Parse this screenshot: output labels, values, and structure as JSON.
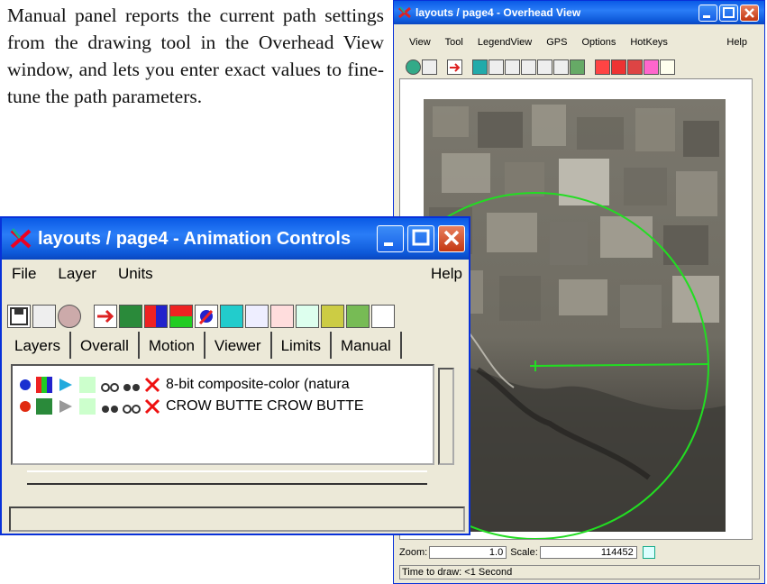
{
  "doc": {
    "paragraph": "Manual panel reports the current path settings from the drawing tool in the Overhead View window, and lets you enter exact values to fine-tune the path parameters."
  },
  "overhead_view": {
    "title": "layouts / page4 - Overhead View",
    "menu": [
      "View",
      "Tool",
      "LegendView",
      "GPS",
      "Options",
      "HotKeys"
    ],
    "menu_help": "Help",
    "zoom_label": "Zoom:",
    "zoom_value": "1.0",
    "scale_label": "Scale:",
    "scale_value": "114452",
    "time_to_draw": "Time to draw: <1 Second"
  },
  "animation_controls": {
    "title": "layouts / page4 - Animation Controls",
    "menu": [
      "File",
      "Layer",
      "Units"
    ],
    "menu_help": "Help",
    "tabs": [
      "Layers",
      "Overall",
      "Motion",
      "Viewer",
      "Limits",
      "Manual"
    ],
    "layers": [
      {
        "name": "8-bit composite-color (natura",
        "dot_color": "#1a2fd0"
      },
      {
        "name": "CROW BUTTE CROW BUTTE",
        "dot_color": "#e02a10"
      }
    ]
  },
  "colors": {
    "xp_title": "#0a5ae6",
    "xp_face": "#ece9d8",
    "path_green": "#22dd22"
  }
}
